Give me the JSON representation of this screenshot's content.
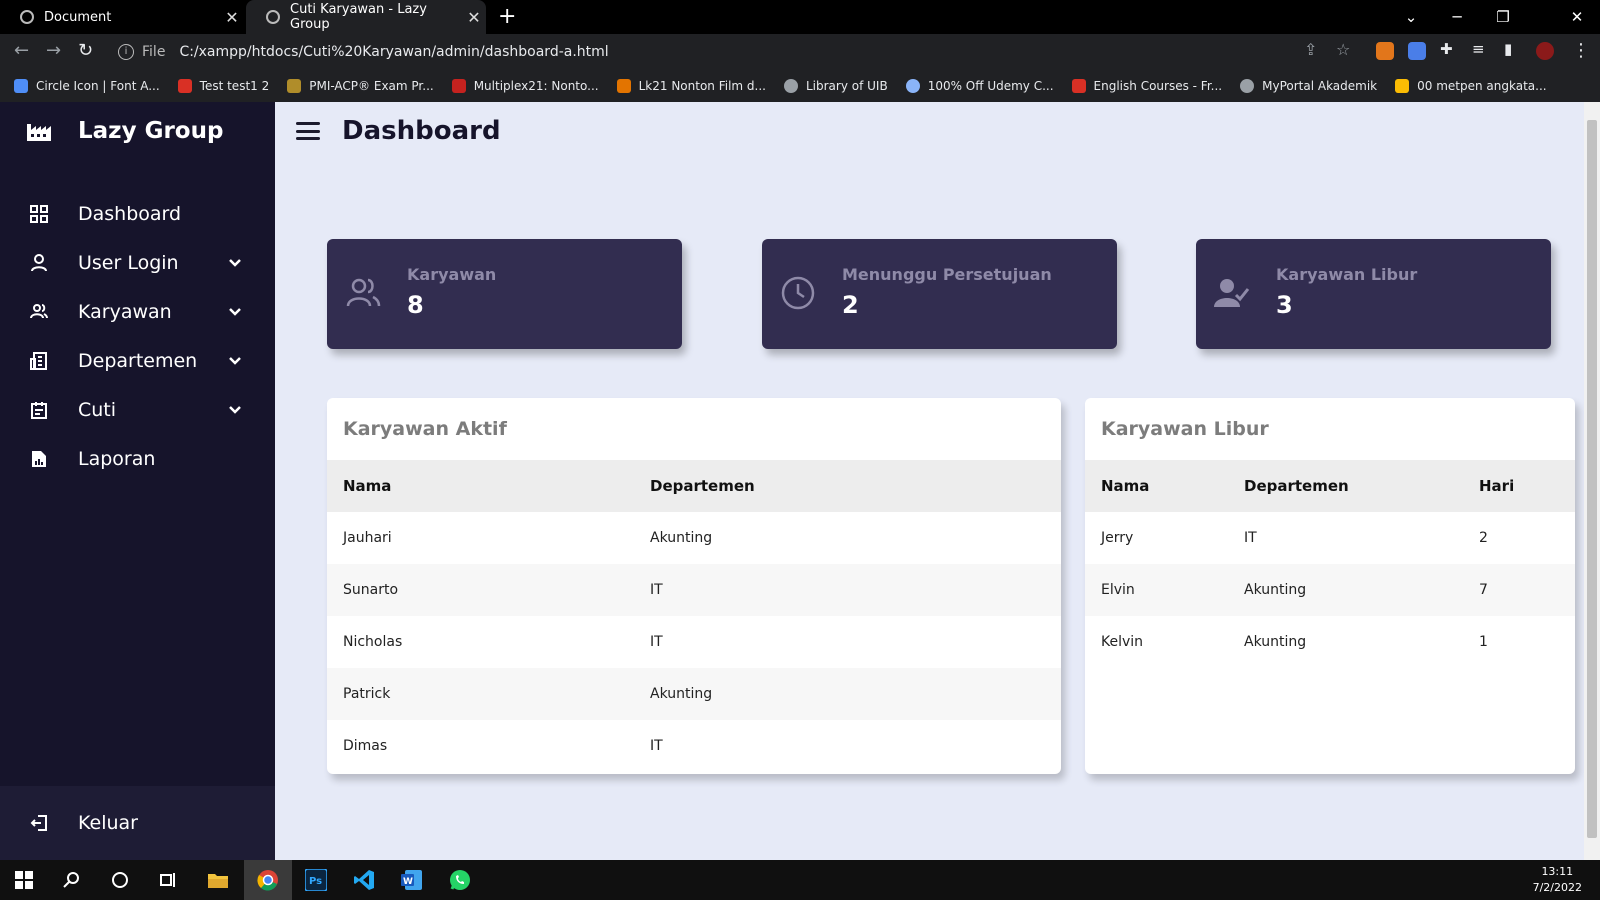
{
  "browser": {
    "tabs": [
      {
        "title": "Document"
      },
      {
        "title": "Cuti Karyawan - Lazy Group"
      }
    ],
    "address": {
      "scheme_label": "File",
      "url": "C:/xampp/htdocs/Cuti%20Karyawan/admin/dashboard-a.html"
    },
    "bookmarks": [
      {
        "label": "Circle Icon | Font A...",
        "color": "#4f8ef7"
      },
      {
        "label": "Test test1 2",
        "color": "#d93025"
      },
      {
        "label": "PMI-ACP® Exam Pr...",
        "color": "#b08d2a"
      },
      {
        "label": "Multiplex21: Nonto...",
        "color": "#c5221f"
      },
      {
        "label": "Lk21 Nonton Film d...",
        "color": "#e37400"
      },
      {
        "label": "Library of UIB",
        "color": "#9aa0a6"
      },
      {
        "label": "100% Off Udemy C...",
        "color": "#8ab4f8"
      },
      {
        "label": "English Courses - Fr...",
        "color": "#d93025"
      },
      {
        "label": "MyPortal Akademik",
        "color": "#9aa0a6"
      },
      {
        "label": "00 metpen angkata...",
        "color": "#fbbc04"
      }
    ]
  },
  "sidebar": {
    "brand": "Lazy Group",
    "items": [
      {
        "label": "Dashboard",
        "icon": "grid-icon"
      },
      {
        "label": "User Login",
        "icon": "user-icon",
        "has_submenu": true
      },
      {
        "label": "Karyawan",
        "icon": "users-icon",
        "has_submenu": true
      },
      {
        "label": "Departemen",
        "icon": "building-icon",
        "has_submenu": true
      },
      {
        "label": "Cuti",
        "icon": "calendar-icon",
        "has_submenu": true
      },
      {
        "label": "Laporan",
        "icon": "file-icon"
      }
    ],
    "logout": "Keluar"
  },
  "header": {
    "title": "Dashboard"
  },
  "stats": [
    {
      "label": "Karyawan",
      "value": "8",
      "icon": "users-icon"
    },
    {
      "label": "Menunggu Persetujuan",
      "value": "2",
      "icon": "clock-icon"
    },
    {
      "label": "Karyawan Libur",
      "value": "3",
      "icon": "user-check-icon"
    }
  ],
  "active_table": {
    "title": "Karyawan Aktif",
    "columns": [
      "Nama",
      "Departemen"
    ],
    "rows": [
      [
        "Jauhari",
        "Akunting"
      ],
      [
        "Sunarto",
        "IT"
      ],
      [
        "Nicholas",
        "IT"
      ],
      [
        "Patrick",
        "Akunting"
      ],
      [
        "Dimas",
        "IT"
      ]
    ]
  },
  "leave_table": {
    "title": "Karyawan Libur",
    "columns": [
      "Nama",
      "Departemen",
      "Hari"
    ],
    "rows": [
      [
        "Jerry",
        "IT",
        "2"
      ],
      [
        "Elvin",
        "Akunting",
        "7"
      ],
      [
        "Kelvin",
        "Akunting",
        "1"
      ]
    ]
  },
  "taskbar": {
    "time": "13:11",
    "date": "7/2/2022"
  },
  "colors": {
    "sidebar": "#16142b",
    "stat_card": "#322d50",
    "page_bg": "#e6eaf7"
  }
}
